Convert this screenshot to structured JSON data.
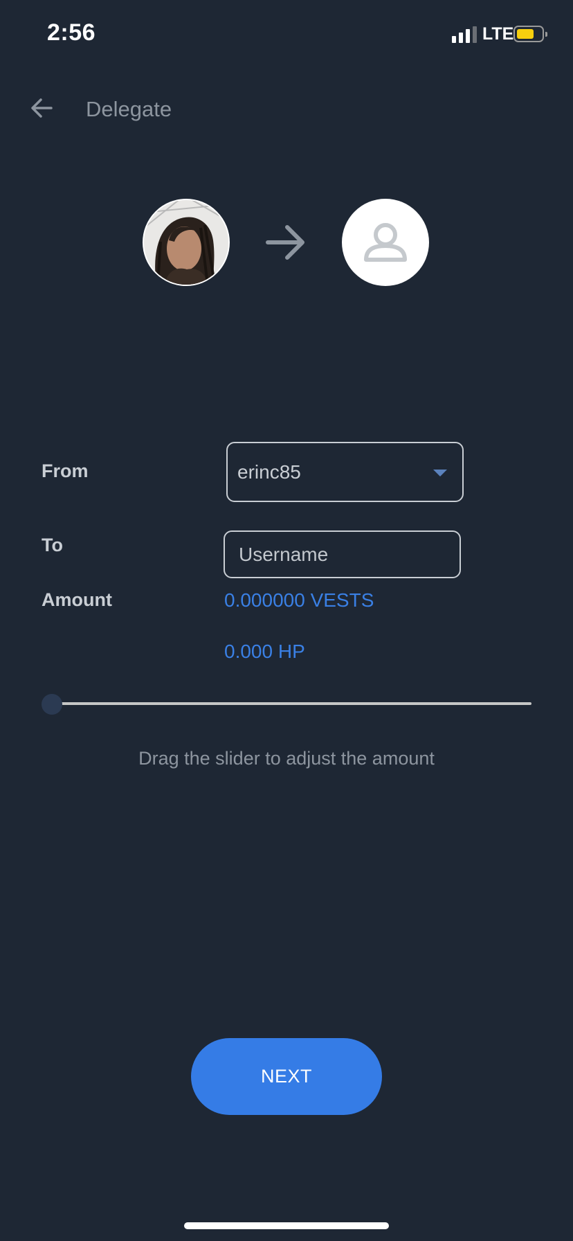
{
  "status_bar": {
    "time": "2:56",
    "network": "LTE"
  },
  "header": {
    "title": "Delegate"
  },
  "form": {
    "from_label": "From",
    "from_value": "erinc85",
    "to_label": "To",
    "to_placeholder": "Username",
    "amount_label": "Amount",
    "vests": "0.000000 VESTS",
    "hp": "0.000 HP"
  },
  "slider": {
    "value": 0,
    "hint": "Drag the slider to adjust the amount"
  },
  "actions": {
    "next_label": "NEXT"
  },
  "colors": {
    "background": "#1e2734",
    "accent": "#357ce6",
    "amount_text": "#3a80e5",
    "battery": "#f6cf0e"
  }
}
